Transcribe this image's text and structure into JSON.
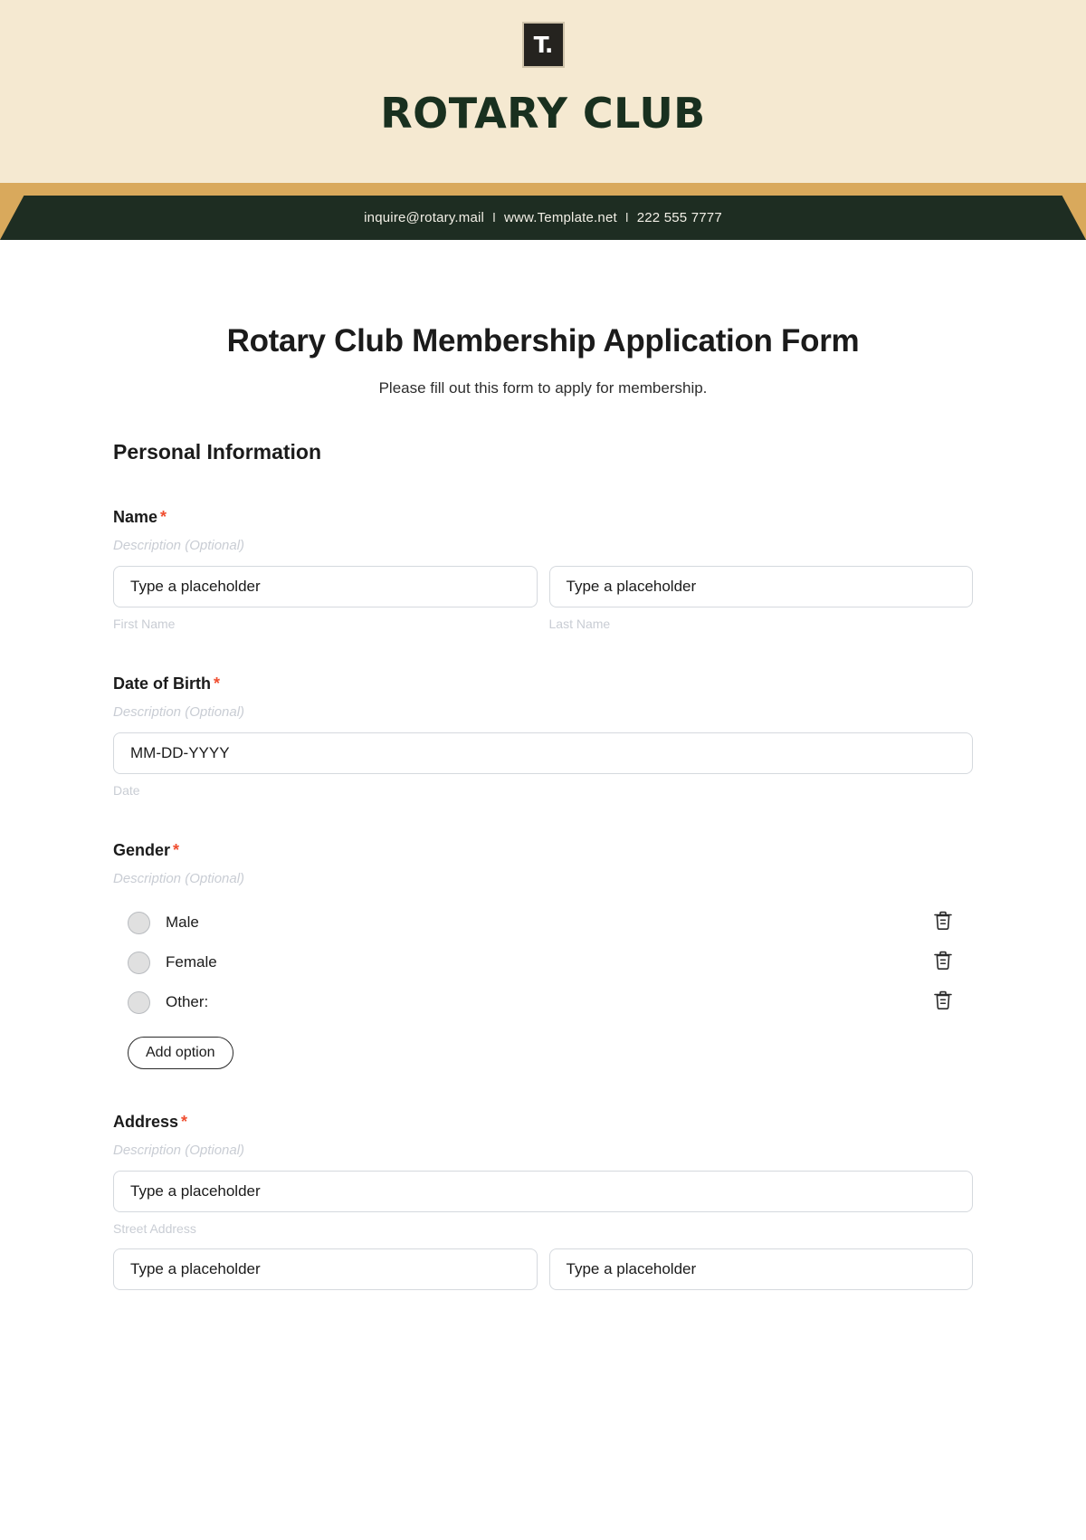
{
  "letterhead": {
    "logo_mark": "T.",
    "club_name": "ROTARY CLUB",
    "contact": {
      "email": "inquire@rotary.mail",
      "separator": "  I  ",
      "website": "www.Template.net",
      "phone": "222 555 7777"
    },
    "colors": {
      "cream": "#f5e9d1",
      "gold": "#d9a95c",
      "dark_green": "#1e2d22",
      "logo_black": "#25231f"
    }
  },
  "form": {
    "title": "Rotary Club Membership Application Form",
    "subtitle": "Please fill out this form to apply for membership.",
    "section_heading": "Personal Information",
    "required_marker": "*",
    "description_placeholder": "Description (Optional)",
    "add_option_label": "Add option",
    "accent_required_color": "#f04e30",
    "fields": [
      {
        "label": "Name",
        "required": true,
        "description": "Description (Optional)",
        "type": "text-pair",
        "inputs": [
          {
            "value": "Type a placeholder",
            "sub_label": "First Name"
          },
          {
            "value": "Type a placeholder",
            "sub_label": "Last Name"
          }
        ]
      },
      {
        "label": "Date of Birth",
        "required": true,
        "description": "Description (Optional)",
        "type": "date",
        "inputs": [
          {
            "value": "MM-DD-YYYY",
            "sub_label": "Date"
          }
        ]
      },
      {
        "label": "Gender",
        "required": true,
        "description": "Description (Optional)",
        "type": "radio",
        "options": [
          {
            "label": "Male",
            "selected": false,
            "delete_icon": "trash-icon"
          },
          {
            "label": "Female",
            "selected": false,
            "delete_icon": "trash-icon"
          },
          {
            "label": "Other:",
            "selected": false,
            "delete_icon": "trash-icon"
          }
        ]
      },
      {
        "label": "Address",
        "required": true,
        "description": "Description (Optional)",
        "type": "address",
        "inputs": [
          {
            "value": "Type a placeholder",
            "sub_label": "Street Address"
          },
          {
            "value": "Type a placeholder",
            "sub_label": ""
          },
          {
            "value": "Type a placeholder",
            "sub_label": ""
          }
        ]
      }
    ]
  }
}
